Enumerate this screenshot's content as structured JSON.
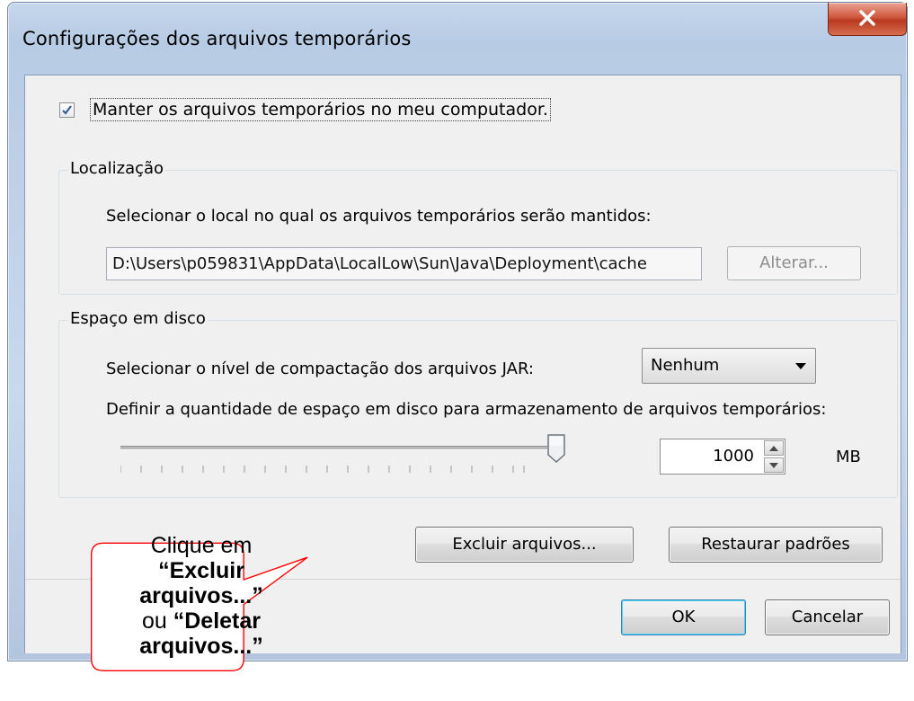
{
  "window": {
    "title": "Configurações dos arquivos temporários",
    "close_symbol": "X"
  },
  "keep_files": {
    "checked": true,
    "label": "Manter os arquivos temporários no meu computador."
  },
  "location": {
    "group_label": "Localização",
    "prompt": "Selecionar o local no qual os arquivos temporários serão mantidos:",
    "path": "D:\\Users\\p059831\\AppData\\LocalLow\\Sun\\Java\\Deployment\\cache",
    "change_button": "Alterar..."
  },
  "disk_space": {
    "group_label": "Espaço em disco",
    "compression_label": "Selecionar o nível de compactação dos arquivos JAR:",
    "compression_value": "Nenhum",
    "amount_label": "Definir a quantidade de espaço em disco para armazenamento de arquivos temporários:",
    "slider_level": 1.0,
    "spinner_value": "1000",
    "unit": "MB"
  },
  "actions": {
    "delete_files": "Excluir arquivos...",
    "restore_defaults": "Restaurar padrões"
  },
  "footer": {
    "ok": "OK",
    "cancel": "Cancelar"
  },
  "callout": {
    "line1": "Clique em",
    "line2": "“Excluir",
    "line3": "arquivos...”",
    "line4_prefix": "ou ",
    "line4_bold": "“Deletar",
    "line5": "arquivos...”",
    "border_color": "#ff0000"
  }
}
